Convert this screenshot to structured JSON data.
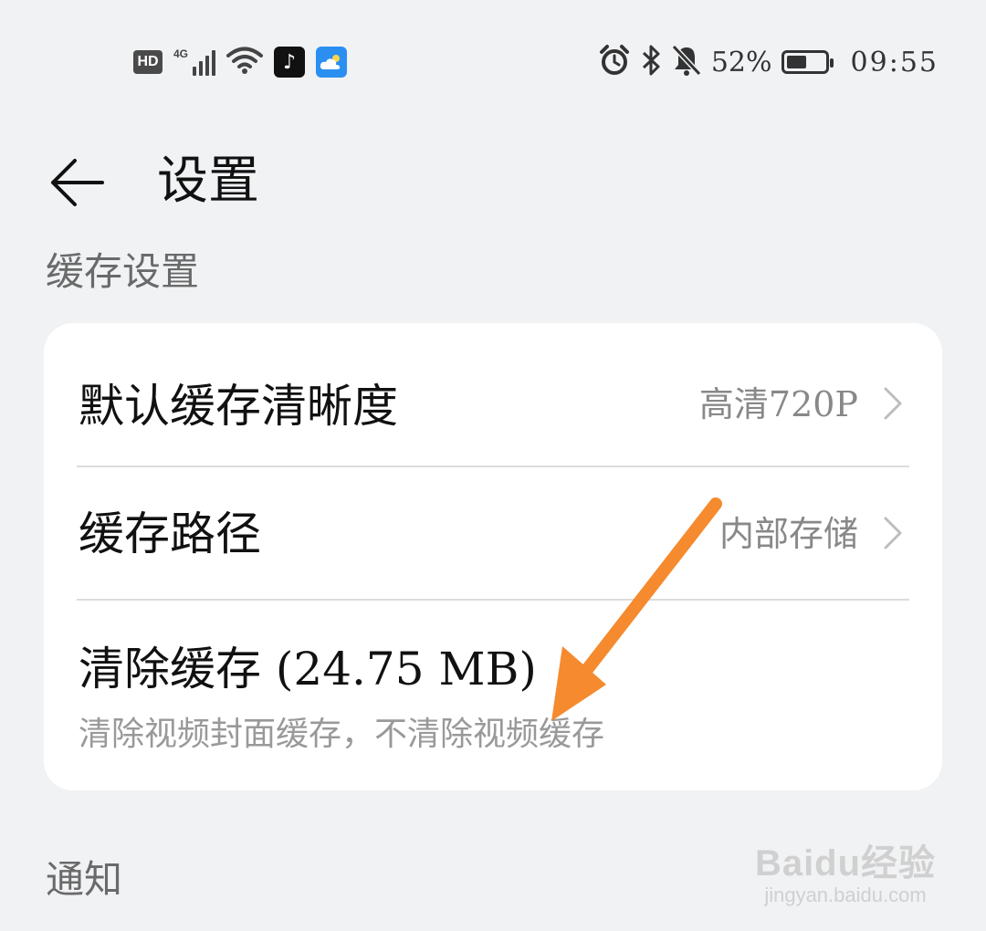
{
  "status_bar": {
    "hd_label": "HD",
    "network_type": "4G",
    "battery_percent_text": "52%",
    "battery_level": 0.52,
    "time": "09:55",
    "left_icons": [
      "hd-icon",
      "signal-icon",
      "wifi-icon",
      "tiktok-icon",
      "weather-icon"
    ],
    "right_icons": [
      "alarm-icon",
      "bluetooth-icon",
      "mute-bell-icon",
      "battery-icon"
    ]
  },
  "header": {
    "back_icon": "arrow-left-icon",
    "title": "设置"
  },
  "cache_section": {
    "title": "缓存设置",
    "items": [
      {
        "label": "默认缓存清晰度",
        "value": "高清720P",
        "icon": "chevron-right-icon"
      },
      {
        "label": "缓存路径",
        "value": "内部存储",
        "icon": "chevron-right-icon"
      },
      {
        "label": "清除缓存 (24.75 MB)",
        "subtitle": "清除视频封面缓存，不清除视频缓存"
      }
    ]
  },
  "notify_section": {
    "title": "通知"
  },
  "annotation": {
    "color": "#f58a2e"
  },
  "watermark": {
    "brand": "Baidu经验",
    "url": "jingyan.baidu.com"
  }
}
